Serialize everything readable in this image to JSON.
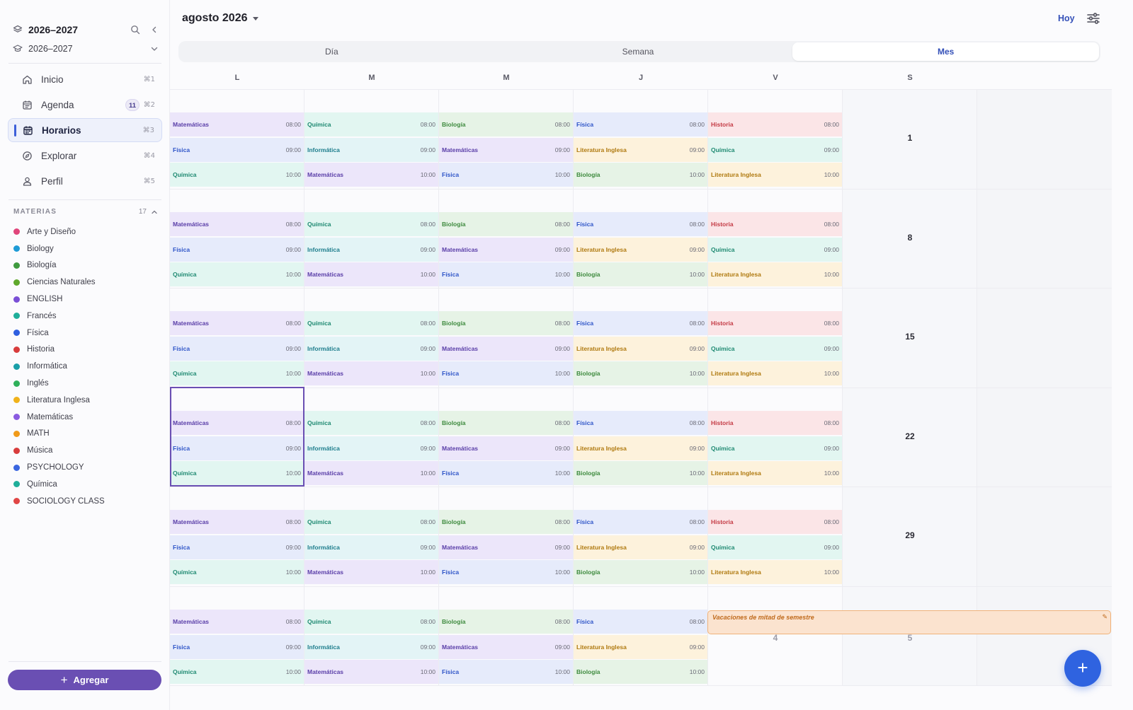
{
  "sidebar": {
    "workspace_name": "2026–2027",
    "workspace_sub": "2026–2027",
    "nav": [
      {
        "label": "Inicio",
        "shortcut": "⌘1",
        "icon": "home-icon"
      },
      {
        "label": "Agenda",
        "shortcut": "⌘2",
        "icon": "calendar-list-icon",
        "badge": "11"
      },
      {
        "label": "Horarios",
        "shortcut": "⌘3",
        "icon": "calendar-icon",
        "active": true
      },
      {
        "label": "Explorar",
        "shortcut": "⌘4",
        "icon": "compass-icon"
      },
      {
        "label": "Perfil",
        "shortcut": "⌘5",
        "icon": "person-icon"
      }
    ],
    "subjects_title": "MATERIAS",
    "subjects_count": "17",
    "subjects": [
      {
        "name": "Arte y Diseño",
        "color": "#e0457b"
      },
      {
        "name": "Biology",
        "color": "#1e9bd6"
      },
      {
        "name": "Biología",
        "color": "#3f9a3f"
      },
      {
        "name": "Ciencias Naturales",
        "color": "#5fa82c"
      },
      {
        "name": "ENGLISH",
        "color": "#7a4fd6"
      },
      {
        "name": "Francés",
        "color": "#1fae9a"
      },
      {
        "name": "Física",
        "color": "#2f5fe0"
      },
      {
        "name": "Historia",
        "color": "#d83c3c"
      },
      {
        "name": "Informática",
        "color": "#1a9fa8"
      },
      {
        "name": "Inglés",
        "color": "#2fb05a"
      },
      {
        "name": "Literatura Inglesa",
        "color": "#f0b21a"
      },
      {
        "name": "Matemáticas",
        "color": "#8a5be0"
      },
      {
        "name": "MATH",
        "color": "#f09a1a"
      },
      {
        "name": "Música",
        "color": "#d83c3c"
      },
      {
        "name": "PSYCHOLOGY",
        "color": "#3a66e0"
      },
      {
        "name": "Química",
        "color": "#1fae9a"
      },
      {
        "name": "SOCIOLOGY CLASS",
        "color": "#e04545"
      }
    ],
    "add_label": "Agregar"
  },
  "header": {
    "month": "agosto 2026",
    "today": "Hoy"
  },
  "views": [
    "Día",
    "Semana",
    "Mes"
  ],
  "active_view": "Mes",
  "weekdays": [
    "L",
    "M",
    "M",
    "J",
    "V",
    "S"
  ],
  "saturday_numbers": [
    "1",
    "8",
    "15",
    "22",
    "29",
    "5"
  ],
  "friday_last_number": "4",
  "events": {
    "L": [
      {
        "subject": "Matemáticas",
        "time": "08:00",
        "cls": "c-mat"
      },
      {
        "subject": "Física",
        "time": "09:00",
        "cls": "c-fis"
      },
      {
        "subject": "Química",
        "time": "10:00",
        "cls": "c-qui"
      }
    ],
    "M1": [
      {
        "subject": "Química",
        "time": "08:00",
        "cls": "c-qui"
      },
      {
        "subject": "Informática",
        "time": "09:00",
        "cls": "c-inf"
      },
      {
        "subject": "Matemáticas",
        "time": "10:00",
        "cls": "c-mat"
      }
    ],
    "M2": [
      {
        "subject": "Biología",
        "time": "08:00",
        "cls": "c-bio"
      },
      {
        "subject": "Matemáticas",
        "time": "09:00",
        "cls": "c-mat"
      },
      {
        "subject": "Física",
        "time": "10:00",
        "cls": "c-fis"
      }
    ],
    "J": [
      {
        "subject": "Física",
        "time": "08:00",
        "cls": "c-fis"
      },
      {
        "subject": "Literatura Inglesa",
        "time": "09:00",
        "cls": "c-lit"
      },
      {
        "subject": "Biología",
        "time": "10:00",
        "cls": "c-bio"
      }
    ],
    "V": [
      {
        "subject": "Historia",
        "time": "08:00",
        "cls": "c-his"
      },
      {
        "subject": "Química",
        "time": "09:00",
        "cls": "c-qui"
      },
      {
        "subject": "Literatura Inglesa",
        "time": "10:00",
        "cls": "c-lit"
      }
    ]
  },
  "vacation_label": "Vacaciones de mitad de semestre",
  "colors": {
    "accent": "#3450b8",
    "primary_button": "#6a4fb3",
    "fab": "#2f63e0",
    "vacation": "#f0b27a"
  }
}
